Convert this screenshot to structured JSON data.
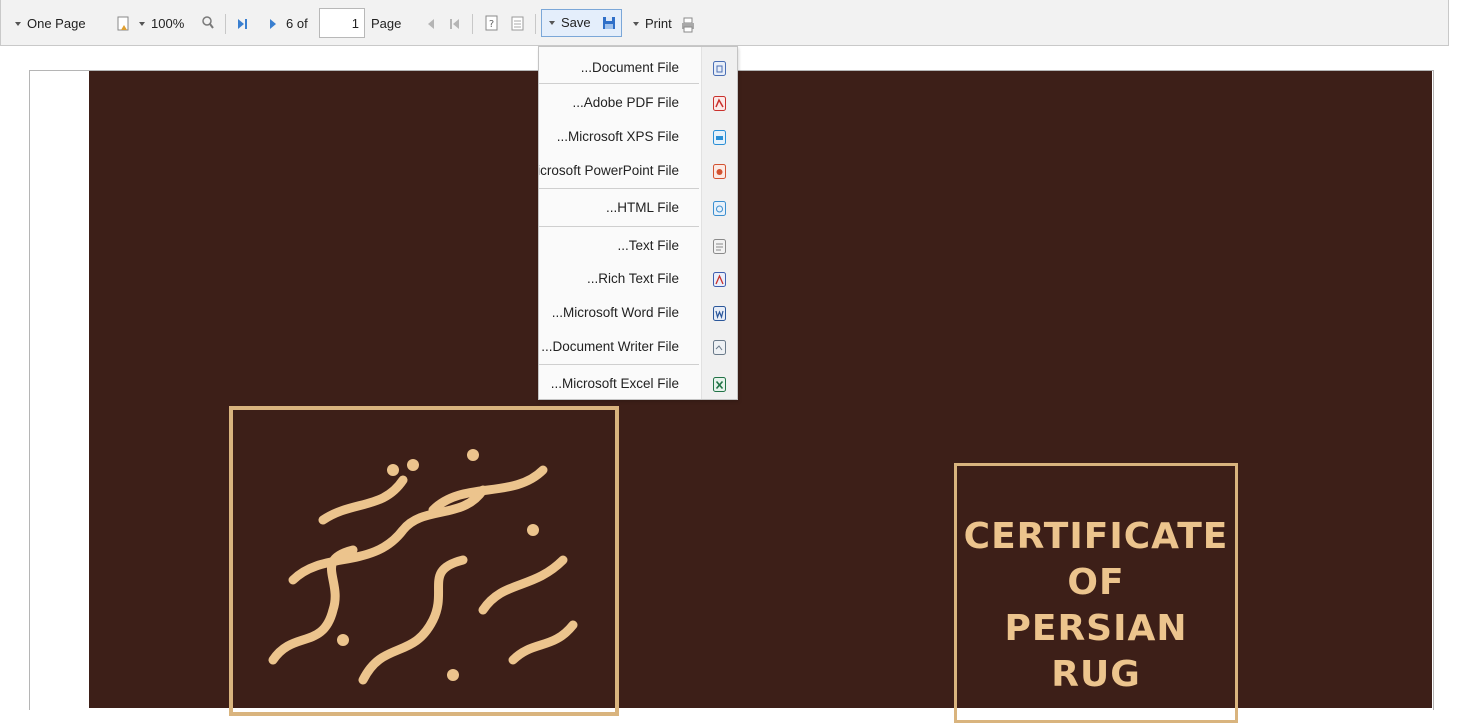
{
  "toolbar": {
    "view_mode_label": "One Page",
    "zoom_label": "100%",
    "page_count_label": "6 of",
    "page_input_value": "1",
    "page_label": "Page",
    "save_label": "Save",
    "print_label": "Print"
  },
  "save_menu": {
    "items": [
      {
        "label": "...Document File",
        "icon": "document-file-icon",
        "color": "#4a6fb5"
      },
      {
        "label": "...Adobe PDF File",
        "icon": "pdf-file-icon",
        "color": "#c9302c"
      },
      {
        "label": "...Microsoft XPS File",
        "icon": "xps-file-icon",
        "color": "#2a8fd6"
      },
      {
        "label": "Microsoft PowerPoint File",
        "icon": "powerpoint-file-icon",
        "color": "#d35230"
      },
      {
        "label": "...HTML File",
        "icon": "html-file-icon",
        "color": "#3b8fd0"
      },
      {
        "label": "...Text File",
        "icon": "text-file-icon",
        "color": "#8a8a8a"
      },
      {
        "label": "...Rich Text File",
        "icon": "rich-text-file-icon",
        "color": "#3f5fb0"
      },
      {
        "label": "...Microsoft Word File",
        "icon": "word-file-icon",
        "color": "#2b579a"
      },
      {
        "label": "...Document Writer File",
        "icon": "writer-file-icon",
        "color": "#6a7a8a"
      },
      {
        "label": "...Microsoft Excel File",
        "icon": "excel-file-icon",
        "color": "#217346"
      }
    ]
  },
  "document": {
    "cover_color": "#3d1f18",
    "accent_color": "#d9b47e",
    "certificate_lines": [
      "CERTIFICATE",
      "OF",
      "PERSIAN",
      "RUG"
    ]
  }
}
